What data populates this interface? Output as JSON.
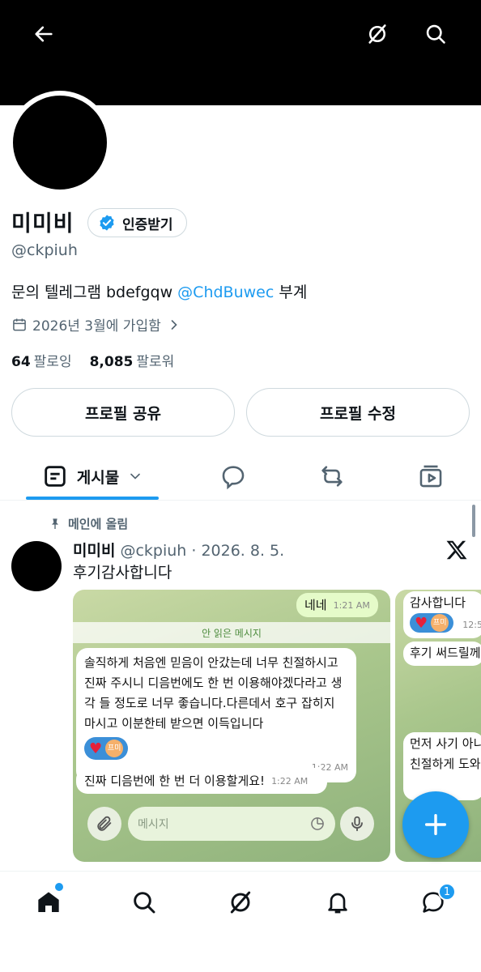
{
  "header": {
    "back_icon": "arrow-left-icon",
    "grok_icon": "grok-icon",
    "search_icon": "search-icon"
  },
  "profile": {
    "name": "미미비",
    "verify_label": "인증받기",
    "handle": "@ckpiuh",
    "bio_prefix": "문의 텔레그램 bdefgqw ",
    "bio_mention": "@ChdBuwec",
    "bio_suffix": " 부계",
    "joined": "2026년 3월에 가입함",
    "following_count": "64",
    "following_label": "팔로잉",
    "followers_count": "8,085",
    "followers_label": "팔로워"
  },
  "actions": {
    "share_label": "프로필 공유",
    "edit_label": "프로필 수정"
  },
  "tabs": {
    "posts_label": "게시물"
  },
  "post": {
    "pinned_label": "메인에 올림",
    "author": "미미비",
    "meta": "@ckpiuh · 2026. 8. 5.",
    "text": "후기감사합니다"
  },
  "media": {
    "msg_nene": "네네",
    "msg_nene_time": "1:21 AM",
    "unread_label": "안 읽은 메시지",
    "review": "솔직하게 처음엔 믿음이 안갔는데 너무 친절하시고 진짜 주시니 디음번에도 한 번 이용해야겠다라고 생각 들 정도로 너무 좋습니다.다른데서 호구 잡히지 마시고 이분한테 받으면 이득입니다",
    "review_time": "1:22 AM",
    "react_name": "프미",
    "next_msg": "진짜 디음번에 한 번 더 이용할게요!",
    "next_time": "1:22 AM",
    "input_placeholder": "메시지",
    "side_1": "감사합니다",
    "side_1_time": "12:5",
    "side_2": "후기 써드릴께",
    "side_3": "먼저 사기 아니",
    "side_4": "친절하게 도와"
  },
  "nav": {
    "messages_badge": "1"
  },
  "colors": {
    "accent": "#1d9bf0",
    "muted": "#536471"
  }
}
